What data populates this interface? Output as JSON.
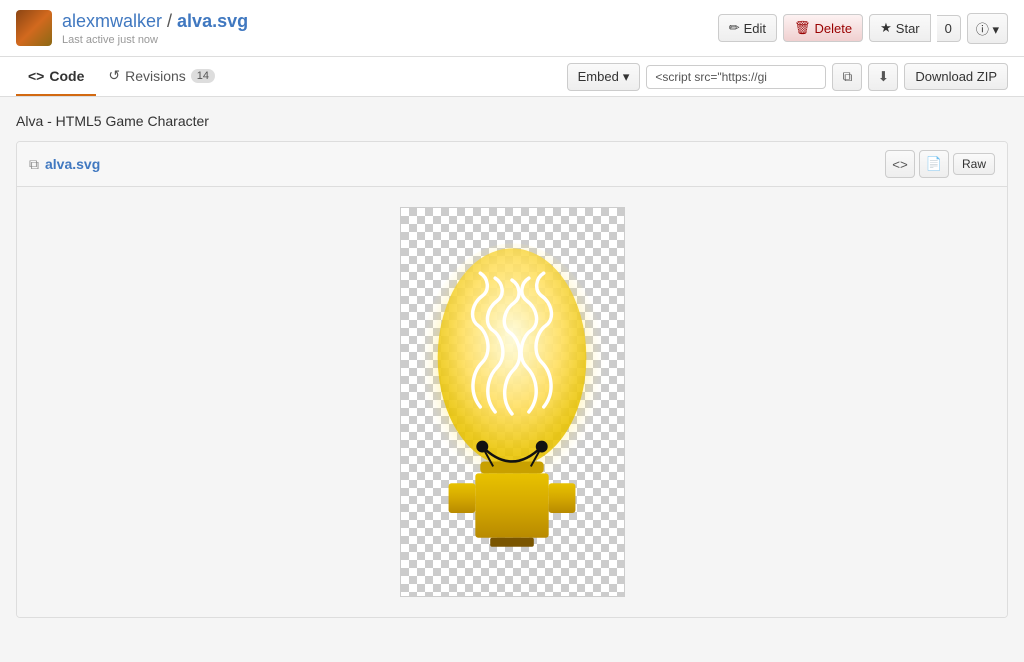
{
  "header": {
    "user": "alexmwalker",
    "slash": " / ",
    "repo": "alva.svg",
    "last_active": "Last active just now",
    "edit_label": "Edit",
    "delete_label": "Delete",
    "star_label": "Star",
    "star_count": "0",
    "info_label": "ⓘ"
  },
  "tabs": {
    "code_label": "Code",
    "revisions_label": "Revisions",
    "revisions_count": "14",
    "embed_label": "Embed",
    "embed_script": "<script src=\"https://gi",
    "download_label": "Download ZIP"
  },
  "page": {
    "description": "Alva - HTML5 Game Character",
    "file_name": "alva.svg",
    "raw_label": "Raw"
  },
  "icons": {
    "edit": "✏️",
    "delete": "🗑",
    "star": "★",
    "code": "<>",
    "revisions_icon": "↺",
    "file_icon": "⧉",
    "code_icon": "<>",
    "doc_icon": "📄",
    "copy_icon": "⊞",
    "download_arrow": "⬇"
  }
}
